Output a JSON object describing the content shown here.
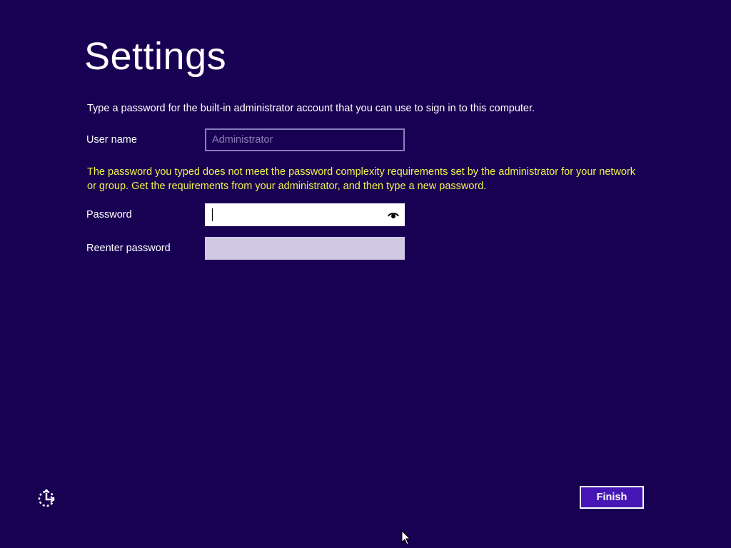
{
  "page": {
    "title": "Settings",
    "instruction": "Type a password for the built-in administrator account that you can use to sign in to this computer."
  },
  "form": {
    "username_label": "User name",
    "username_value": "Administrator",
    "warning": "The password you typed does not meet the password complexity requirements set by the administrator for your network or group. Get the requirements from your administrator, and then type a new password.",
    "password_label": "Password",
    "password_value": "",
    "reenter_label": "Reenter password",
    "reenter_value": ""
  },
  "footer": {
    "finish_label": "Finish"
  },
  "icons": {
    "reveal": "eye-icon",
    "accessibility": "ease-of-access-icon",
    "pointer": "mouse-pointer-icon"
  },
  "colors": {
    "background": "#180052",
    "warning_text": "#f2f24a",
    "button": "#4617b4",
    "disabled_field_border": "#8a7dbd",
    "inactive_field": "#d1c9e3"
  }
}
